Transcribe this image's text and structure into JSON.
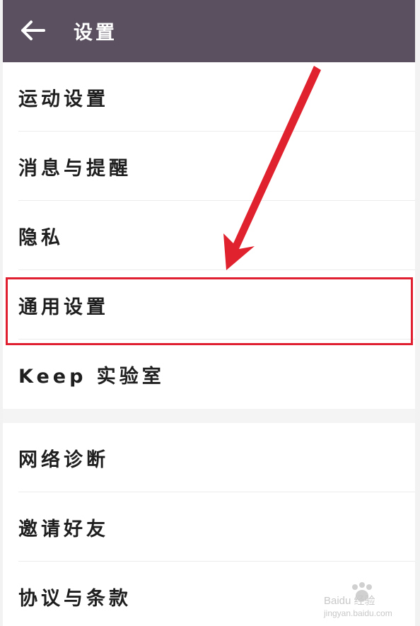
{
  "header": {
    "title": "设置"
  },
  "group1": [
    {
      "label": "运动设置"
    },
    {
      "label": "消息与提醒"
    },
    {
      "label": "隐私"
    },
    {
      "label": "通用设置"
    },
    {
      "label": "Keep 实验室"
    }
  ],
  "group2": [
    {
      "label": "网络诊断"
    },
    {
      "label": "邀请好友"
    },
    {
      "label": "协议与条款"
    }
  ],
  "watermark": {
    "brand": "Baidu 经验",
    "url": "jingyan.baidu.com"
  },
  "colors": {
    "topbar": "#5a5060",
    "highlight": "#e02030"
  }
}
